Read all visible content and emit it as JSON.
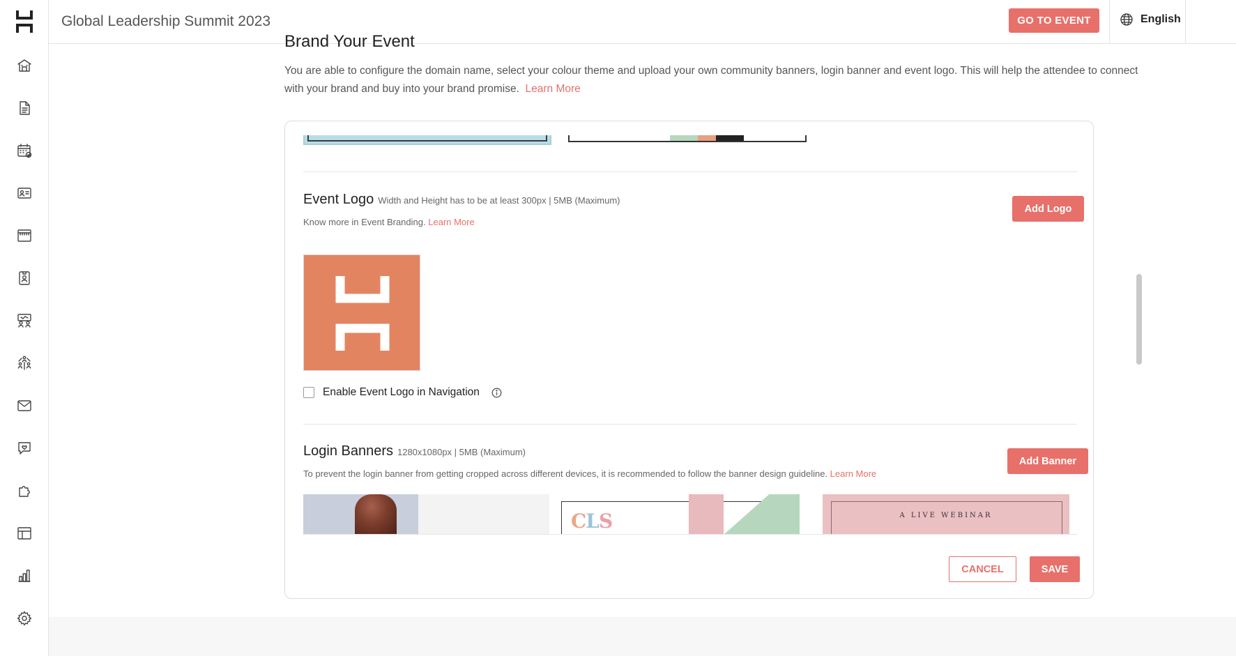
{
  "app": {
    "title": "Global Leadership Summit 2023",
    "go_to_event_label": "GO TO EVENT",
    "language_label": "English",
    "accent_color": "#e8706a"
  },
  "sidebar": {
    "items": [
      {
        "name": "home",
        "icon": "venue-icon"
      },
      {
        "name": "document",
        "icon": "document-icon"
      },
      {
        "name": "schedule",
        "icon": "calendar-icon"
      },
      {
        "name": "people",
        "icon": "id-card-icon"
      },
      {
        "name": "booths",
        "icon": "booth-icon"
      },
      {
        "name": "badge",
        "icon": "badge-icon"
      },
      {
        "name": "rooms",
        "icon": "meeting-room-icon"
      },
      {
        "name": "networking",
        "icon": "networking-icon"
      },
      {
        "name": "email",
        "icon": "mail-icon"
      },
      {
        "name": "engagement",
        "icon": "chat-heart-icon"
      },
      {
        "name": "integrations",
        "icon": "puzzle-icon"
      },
      {
        "name": "layout",
        "icon": "layout-icon"
      },
      {
        "name": "analytics",
        "icon": "bar-chart-icon"
      },
      {
        "name": "settings",
        "icon": "gear-icon"
      }
    ]
  },
  "main": {
    "heading": "Brand Your Event",
    "intro": "You are able to configure the domain name, select your colour theme and upload your own community banners, login banner and event logo. This will help the attendee to connect with your brand and buy into your brand promise.",
    "intro_link": "Learn More"
  },
  "event_logo": {
    "title": "Event Logo",
    "hint": "Width and Height has to be at least 300px | 5MB (Maximum)",
    "desc": "Know more in Event Branding.",
    "desc_link": "Learn More",
    "add_label": "Add Logo",
    "checkbox_label": "Enable Event Logo in Navigation"
  },
  "login_banners": {
    "title": "Login Banners",
    "hint": "1280x1080px | 5MB (Maximum)",
    "desc": "To prevent the login banner from getting cropped across different devices, it is recommended to follow the banner design guideline.",
    "desc_link": "Learn More",
    "add_label": "Add Banner",
    "banner_texts": [
      "CLS",
      "A LIVE WEBINAR"
    ]
  },
  "actions": {
    "cancel_label": "CANCEL",
    "save_label": "SAVE"
  }
}
